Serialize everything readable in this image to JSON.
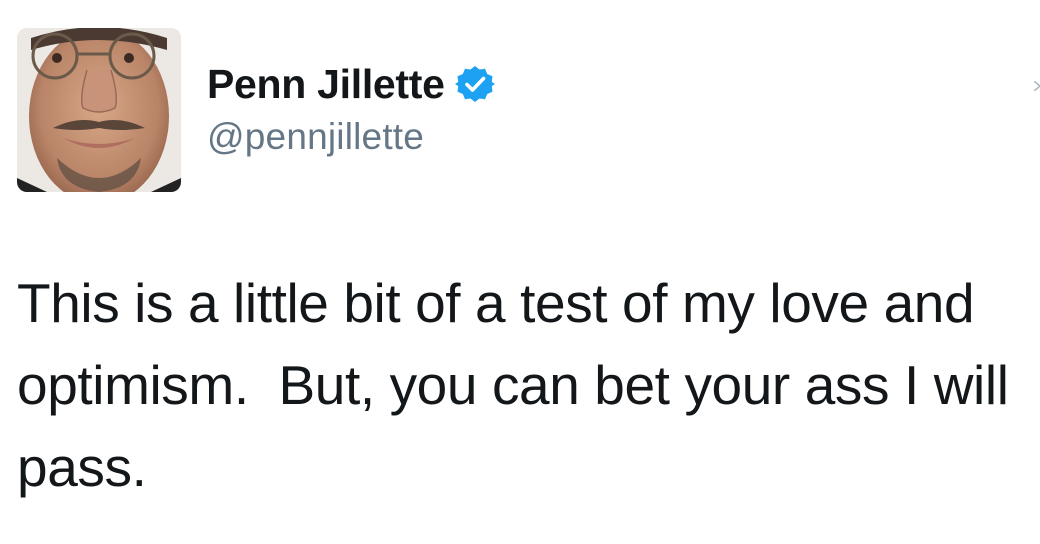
{
  "author": {
    "display_name": "Penn Jillette",
    "handle": "@pennjillette",
    "verified": true,
    "avatar_icon": "profile-photo",
    "verified_icon": "verified-badge-icon"
  },
  "tweet": {
    "text": "This is a little bit of a test of my love and optimism.  But, you can bet your ass I will pass."
  },
  "colors": {
    "name": "#14171a",
    "handle": "#657786",
    "verified": "#1da1f2",
    "text": "#14171a"
  }
}
